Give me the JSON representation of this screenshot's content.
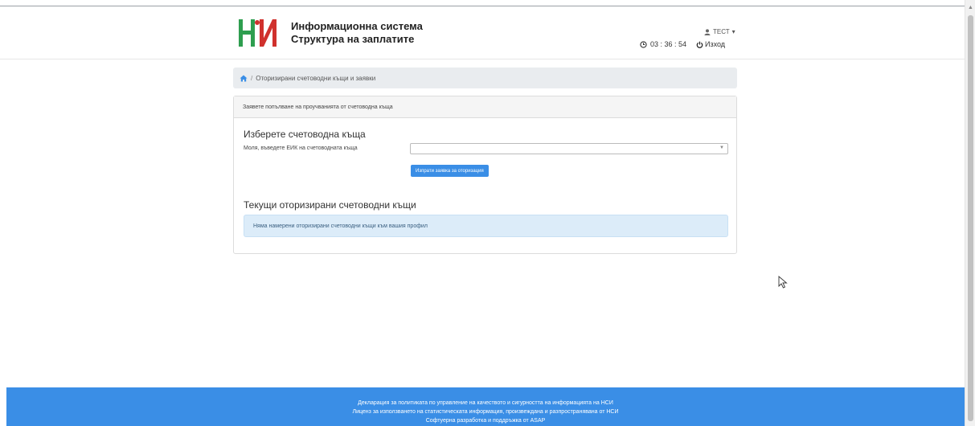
{
  "header": {
    "title_line1": "Информационна система",
    "title_line2": "Структура на заплатите",
    "user_name": "ТЕСТ",
    "timer": "03 : 36 : 54",
    "logout_label": "Изход"
  },
  "breadcrumb": {
    "current": "Оторизирани счетоводни къщи и заявки"
  },
  "card": {
    "header_text": "Заявете попълване на проучванията от счетоводна къща",
    "select_section_title": "Изберете счетоводна къща",
    "eik_label": "Моля, въведете ЕИК на счетоводната къща",
    "select_value": "",
    "submit_label": "Изпрати заявка за оторизация",
    "current_section_title": "Текущи оторизирани счетоводни къщи",
    "empty_message": "Няма намерени оторизирани счетоводни къщи към вашия профил"
  },
  "footer": {
    "line1": "Декларация за политиката по управление на качеството и сигурността на информацията на НСИ",
    "line2": "Лиценз за използването на статистическата информация, произвеждана и разпространявана от НСИ",
    "line3": "Софтуерна разработка и поддръжка от ASAP"
  },
  "colors": {
    "primary": "#3a8ee6",
    "logo_green": "#2e9e4f",
    "logo_red": "#d0312d",
    "alert_bg": "#dcecf9"
  }
}
